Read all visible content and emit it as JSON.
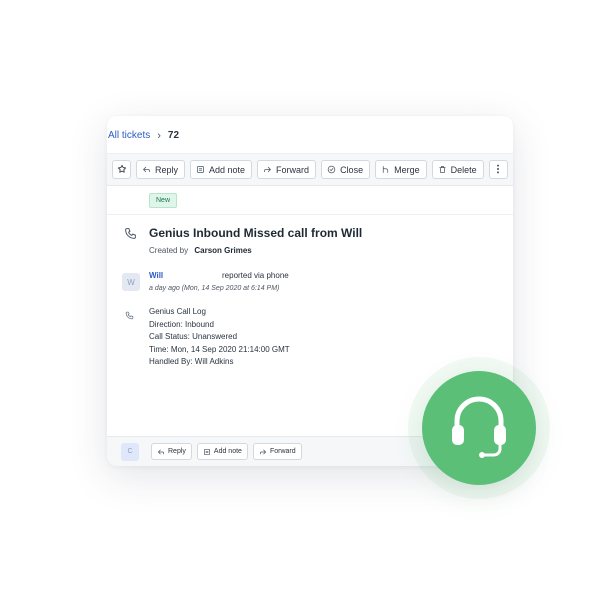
{
  "breadcrumb": {
    "link": "All tickets",
    "separator": "›",
    "ticket_id": "72"
  },
  "toolbar": {
    "star_icon": "star-icon",
    "reply": "Reply",
    "add_note": "Add note",
    "forward": "Forward",
    "close": "Close",
    "merge": "Merge",
    "delete": "Delete",
    "more_icon": "kebab-menu-icon"
  },
  "ticket": {
    "status_badge": "New",
    "subject": "Genius Inbound Missed call from Will",
    "created_by_label": "Created by",
    "created_by_name": "Carson Grimes"
  },
  "message": {
    "avatar_initial": "W",
    "sender": "Will",
    "reported": "reported via phone",
    "time": "a day ago (Mon, 14 Sep 2020 at 6:14 PM)",
    "log_lines": [
      "Genius Call Log",
      "Direction: Inbound",
      "Call Status: Unanswered",
      "Time: Mon, 14 Sep 2020 21:14:00 GMT",
      "Handled By: Will Adkins"
    ]
  },
  "footer": {
    "avatar_initial": "C",
    "reply": "Reply",
    "add_note": "Add note",
    "forward": "Forward"
  },
  "colors": {
    "link": "#2c5cc5",
    "accent_green": "#5cbf78",
    "badge_bg": "#e0f5ea"
  }
}
